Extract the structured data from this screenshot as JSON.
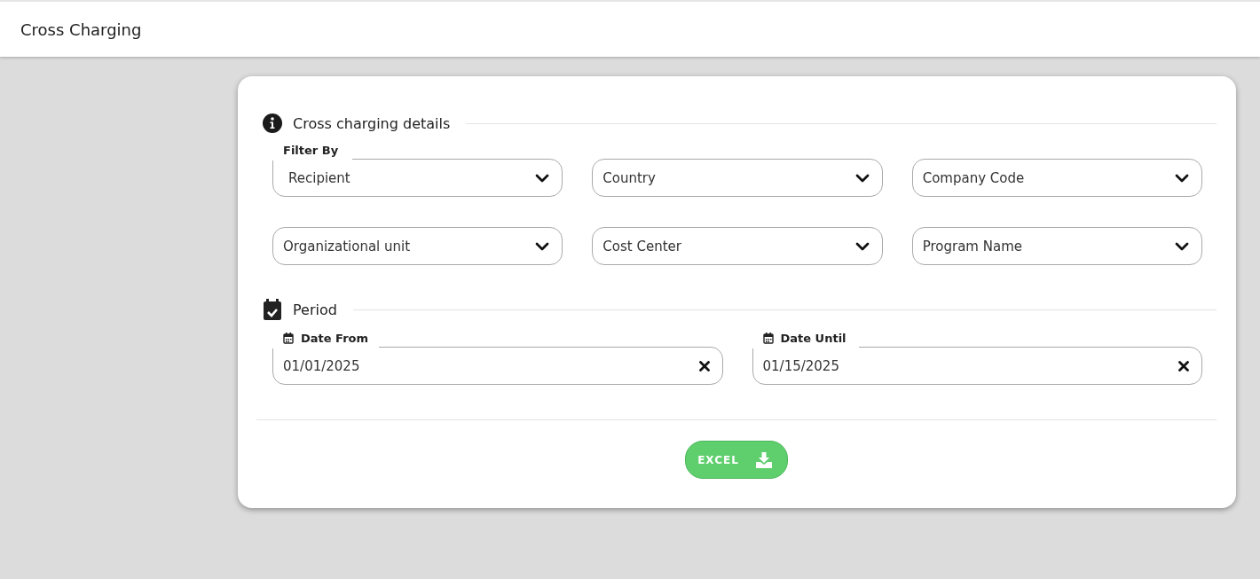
{
  "header": {
    "title": "Cross Charging"
  },
  "details": {
    "title": "Cross charging details",
    "filters": [
      {
        "label": "Filter By",
        "value": "Recipient"
      },
      {
        "placeholder": "Country"
      },
      {
        "placeholder": "Company Code"
      },
      {
        "placeholder": "Organizational unit"
      },
      {
        "placeholder": "Cost Center"
      },
      {
        "placeholder": "Program Name"
      }
    ]
  },
  "period": {
    "title": "Period",
    "dates": [
      {
        "label": "Date From",
        "value": "01/01/2025"
      },
      {
        "label": "Date Until",
        "value": "01/15/2025"
      }
    ]
  },
  "export_button": {
    "label": "EXCEL"
  }
}
